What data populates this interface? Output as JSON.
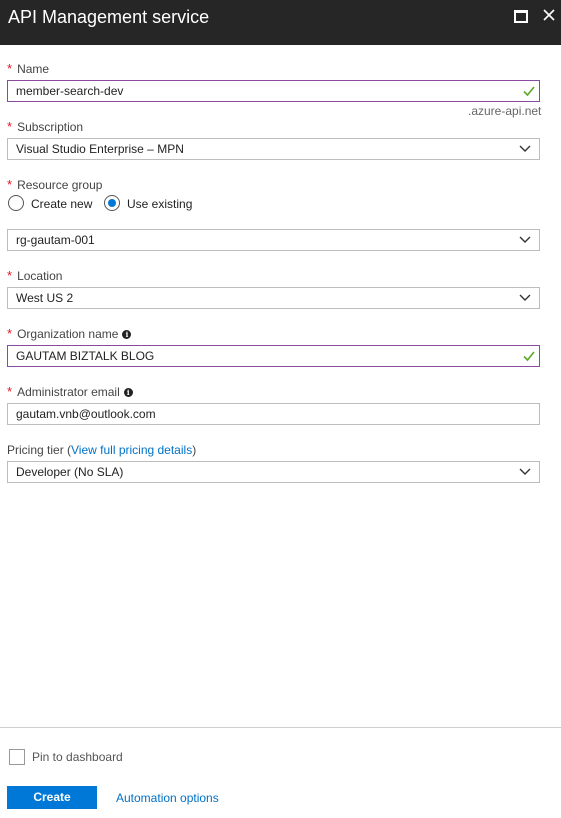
{
  "blade": {
    "title": "API Management service"
  },
  "form": {
    "name": {
      "label": "Name",
      "value": "member-search-dev",
      "suffix": ".azure-api.net"
    },
    "subscription": {
      "label": "Subscription",
      "value": "Visual Studio Enterprise – MPN"
    },
    "resource_group": {
      "label": "Resource group",
      "create_new_label": "Create new",
      "use_existing_label": "Use existing",
      "selected_option": "Use existing",
      "value": "rg-gautam-001"
    },
    "location": {
      "label": "Location",
      "value": "West US 2"
    },
    "organization": {
      "label": "Organization name",
      "value": "GAUTAM BIZTALK BLOG"
    },
    "admin_email": {
      "label": "Administrator email",
      "value": "gautam.vnb@outlook.com"
    },
    "pricing": {
      "label_prefix": "Pricing tier (",
      "link_text": "View full pricing details",
      "label_suffix": ")",
      "value": "Developer (No SLA)"
    }
  },
  "footer": {
    "pin_label": "Pin to dashboard",
    "pin_checked": false,
    "create_label": "Create",
    "automation_label": "Automation options"
  },
  "colors": {
    "header_bg": "#262626",
    "accent": "#0078d7",
    "required": "#e81123",
    "valid_check": "#5ca829",
    "valid_border": "#8a4a9e"
  }
}
